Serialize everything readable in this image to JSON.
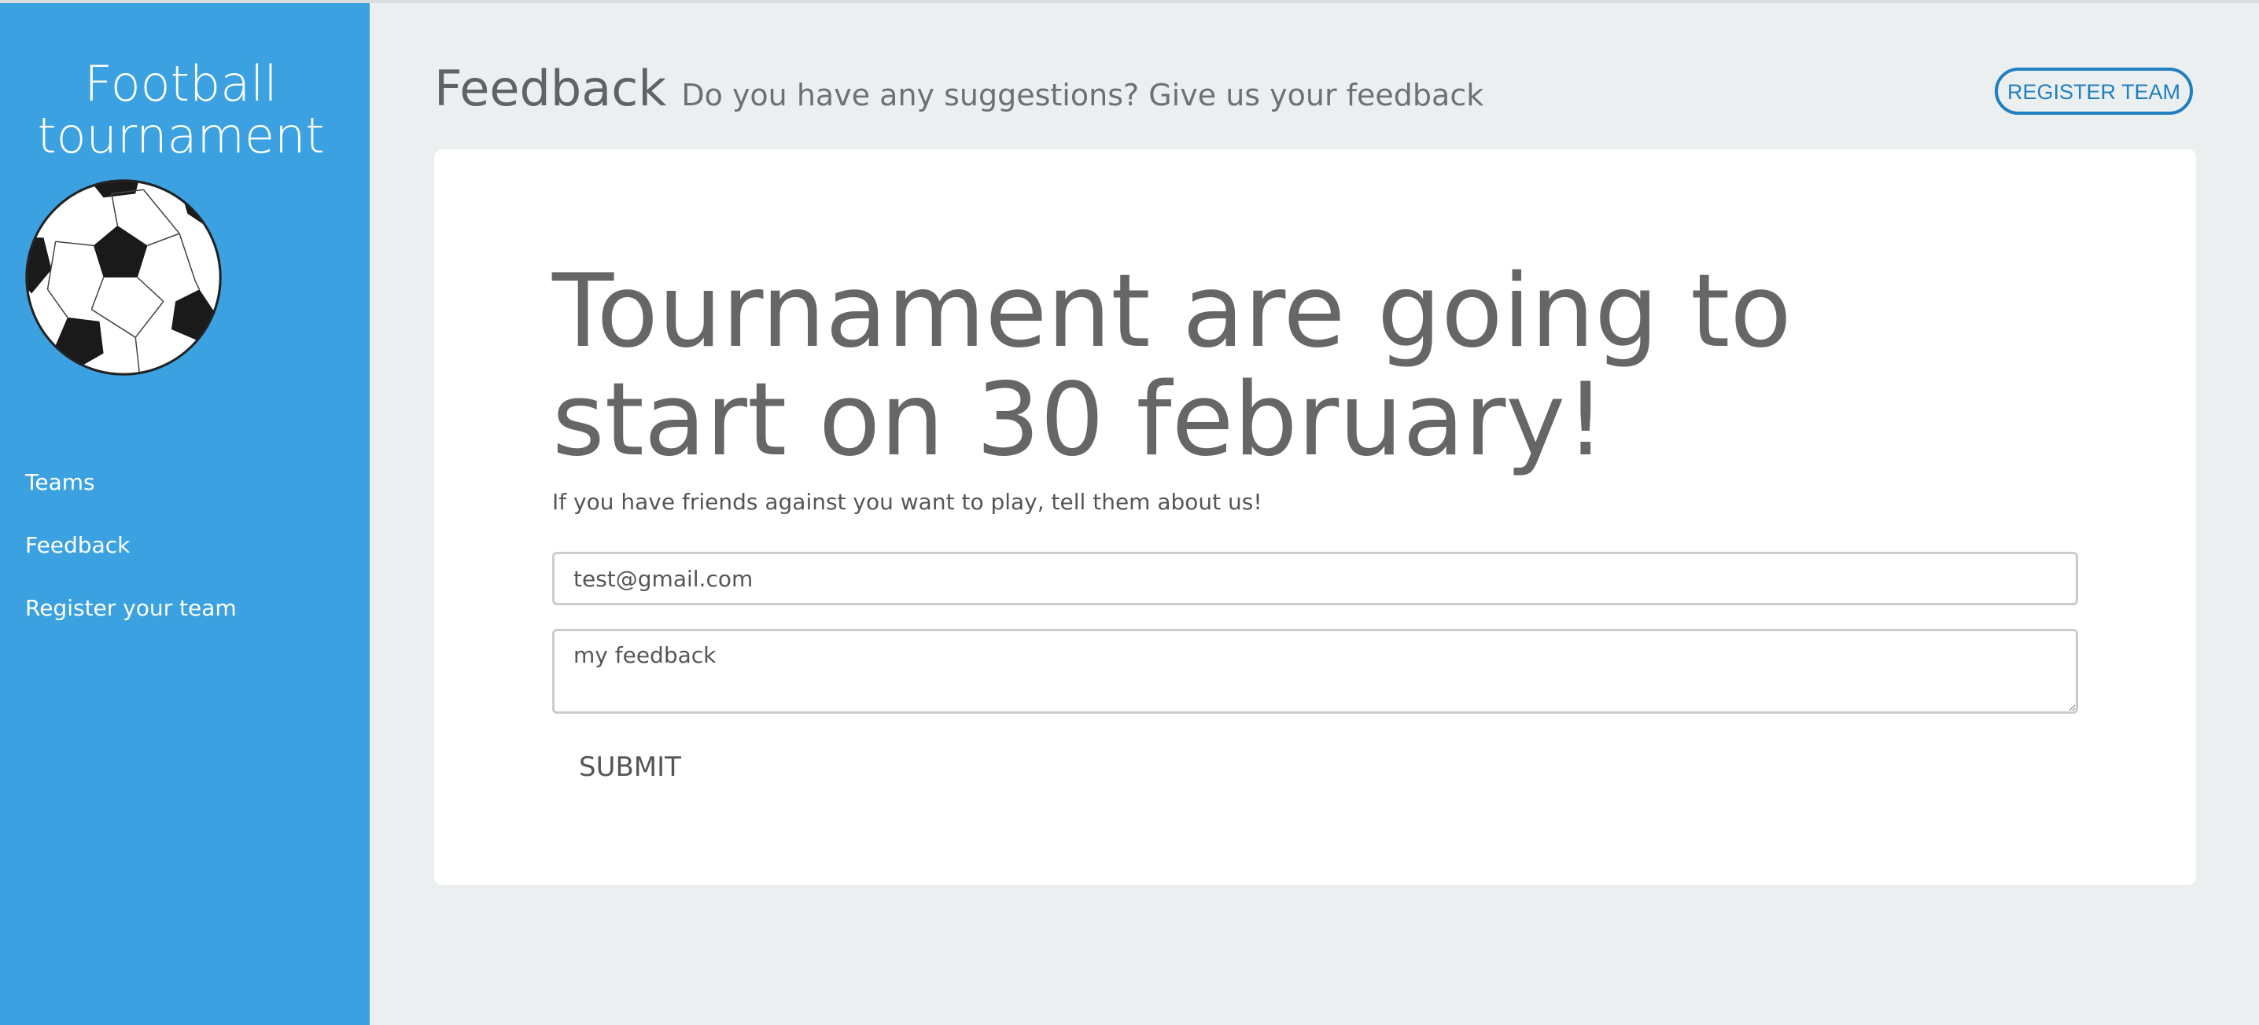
{
  "sidebar": {
    "brand_title": "Football tournament",
    "logo_icon": "soccer-ball-icon",
    "items": [
      {
        "label": "Teams"
      },
      {
        "label": "Feedback"
      },
      {
        "label": "Register your team"
      }
    ]
  },
  "header": {
    "title": "Feedback",
    "subtitle": "Do you have any suggestions? Give us your feedback",
    "register_button": "REGISTER TEAM"
  },
  "main": {
    "headline": "Tournament are going to start on 30 february!",
    "lead": "If you have friends against you want to play, tell them about us!",
    "email_value": "test@gmail.com",
    "feedback_value": "my feedback",
    "submit_label": "SUBMIT"
  },
  "colors": {
    "sidebar": "#3ba1e1",
    "accent": "#1f7fbf",
    "background": "#eceff0",
    "text": "#666666"
  }
}
